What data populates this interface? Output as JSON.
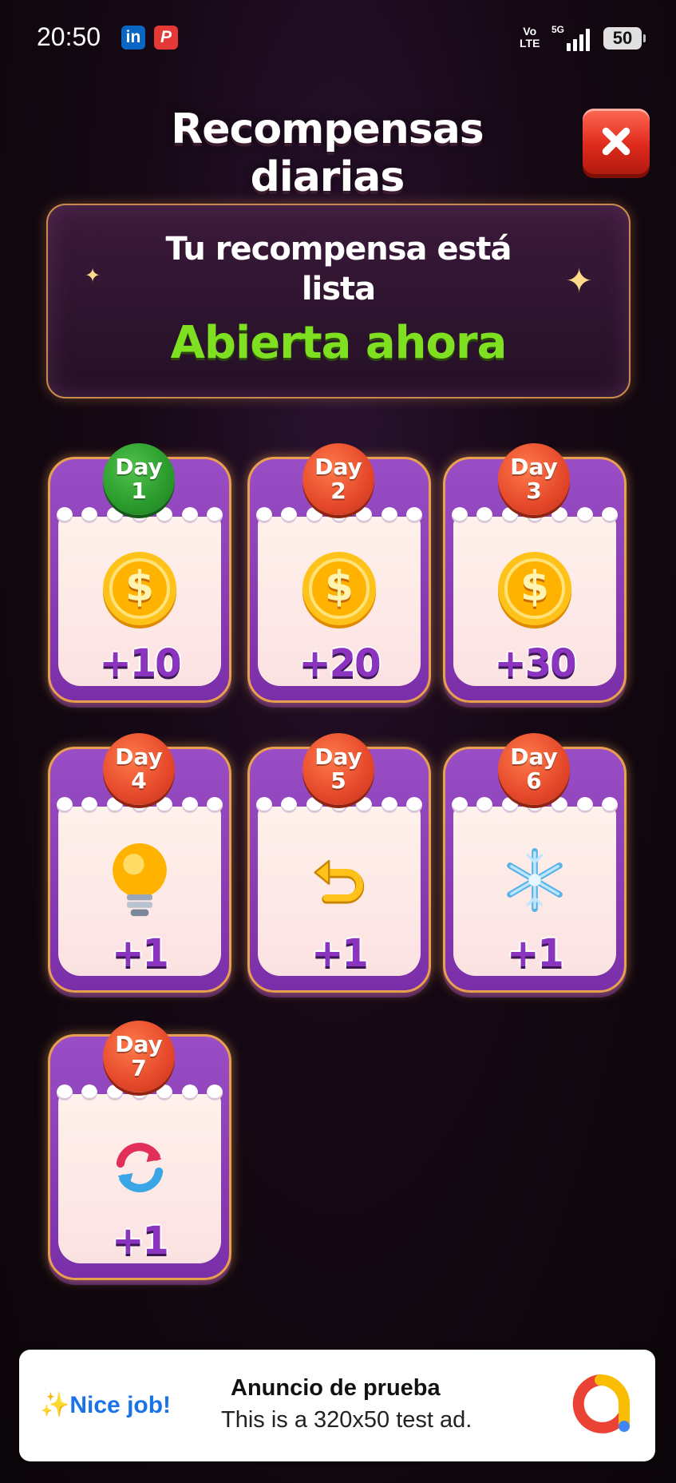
{
  "status_bar": {
    "time": "20:50",
    "app_icons": [
      "in",
      "P"
    ],
    "volte": "Vo\nLTE",
    "network": "5G",
    "battery": "50"
  },
  "header": {
    "title": "Recompensas diarias",
    "close_icon": "close-icon"
  },
  "banner": {
    "line1": "Tu recompensa está",
    "line2": "lista",
    "status": "Abierta ahora",
    "status_color": "#7ee020"
  },
  "rewards": [
    {
      "day_label": "Day",
      "day_num": "1",
      "icon": "coin-icon",
      "amount": "+10",
      "state": "current"
    },
    {
      "day_label": "Day",
      "day_num": "2",
      "icon": "coin-icon",
      "amount": "+20",
      "state": "locked"
    },
    {
      "day_label": "Day",
      "day_num": "3",
      "icon": "coin-icon",
      "amount": "+30",
      "state": "locked"
    },
    {
      "day_label": "Day",
      "day_num": "4",
      "icon": "lightbulb-icon",
      "amount": "+1",
      "state": "locked"
    },
    {
      "day_label": "Day",
      "day_num": "5",
      "icon": "undo-arrow-icon",
      "amount": "+1",
      "state": "locked"
    },
    {
      "day_label": "Day",
      "day_num": "6",
      "icon": "snowflake-icon",
      "amount": "+1",
      "state": "locked"
    },
    {
      "day_label": "Day",
      "day_num": "7",
      "icon": "refresh-icon",
      "amount": "+1",
      "state": "locked"
    }
  ],
  "ad": {
    "sparkle": "✨",
    "nice": "Nice job!",
    "title": "Anuncio de prueba",
    "subtitle": "This is a 320x50 test ad."
  },
  "colors": {
    "accent_green": "#7ee020",
    "badge_green": "#2a9a2c",
    "badge_orange": "#e5482a",
    "card_purple": "#8a3fb8"
  }
}
